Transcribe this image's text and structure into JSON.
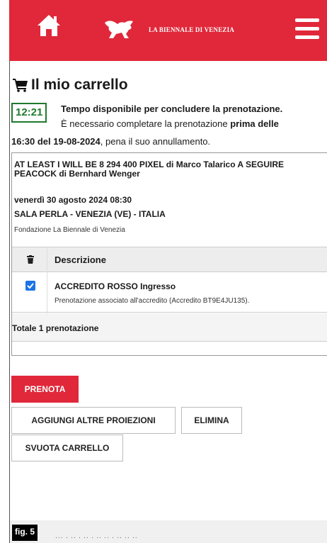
{
  "header": {
    "brand": "LA BIENNALE DI VENEZIA",
    "home_icon": "home-icon",
    "menu_icon": "hamburger-menu-icon",
    "logo_icon": "winged-lion-logo",
    "color": "#e0283a"
  },
  "cart": {
    "title": "Il mio carrello",
    "icon": "cart-icon",
    "timer": "12:21",
    "timer_color": "#1f7a2e",
    "info_line1": "Tempo disponibile per concludere la prenotazione.",
    "info_line2_pre": "È necessario completare la prenotazione ",
    "info_line2_bold": "prima delle",
    "info_line3_bold": "16:30 del 19-08-2024",
    "info_line3_post": ", pena il suo annullamento."
  },
  "event": {
    "title": "AT LEAST I WILL BE 8 294 400 PIXEL di Marco Talarico A SEGUIRE PEACOCK di Bernhard Wenger",
    "date": "venerdì 30 agosto 2024 08:30",
    "venue": "SALA PERLA - VENEZIA (VE) - ITALIA",
    "organizer": "Fondazione La Biennale di Venezia"
  },
  "table": {
    "col_description": "Descrizione",
    "rows": [
      {
        "checked": true,
        "name": "ACCREDITO ROSSO Ingresso",
        "note": "Prenotazione associato all'accredito (Accredito BT9E4JU135)."
      }
    ],
    "total": "Totale 1 prenotazione"
  },
  "actions": {
    "prenota": "PRENOTA",
    "aggiungi": "AGGIUNGI ALTRE PROIEZIONI",
    "elimina": "ELIMINA",
    "svuota": "SVUOTA CARRELLO"
  },
  "footer": {
    "badge": "fig. 5",
    "text": "···  ·  ·· · ·· ·                              ·· ·· · ·· ·· ··"
  }
}
